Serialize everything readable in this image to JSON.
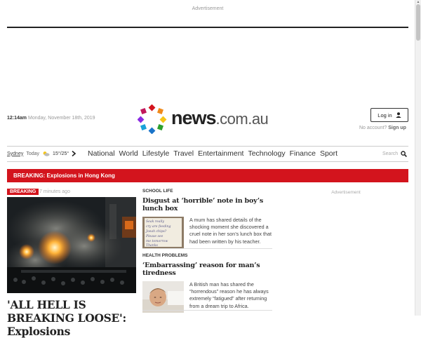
{
  "ads": {
    "top_label": "Advertisement",
    "side_label": "Advertisement"
  },
  "header": {
    "time": "12:14am",
    "date": "Monday, November 18th, 2019",
    "logo_main": "news",
    "logo_domain": ".com.au",
    "login_label": "Log in",
    "no_account_text": "No account?",
    "signup_label": "Sign up"
  },
  "weather": {
    "city": "Sydney",
    "day": "Today",
    "temps": "15°/25°"
  },
  "nav": {
    "items": [
      "National",
      "World",
      "Lifestyle",
      "Travel",
      "Entertainment",
      "Technology",
      "Finance",
      "Sport"
    ],
    "search_label": "Search"
  },
  "breaking_bar": {
    "text": "BREAKING: Explosions in Hong Kong"
  },
  "lead": {
    "tag": "BREAKING",
    "time_ago": "7 minutes ago",
    "headline": "'ALL HELL IS BREAKING LOOSE': Explosions"
  },
  "stories": [
    {
      "category": "SCHOOL LIFE",
      "headline": "Disgust at ‘horrible’ note in boy’s lunch box",
      "summary": "A mum has shared details of the shocking moment she discovered a cruel note in her son’s lunch box that had been written by his teacher.",
      "thumb_text": [
        "Seak really",
        "cry are feeding",
        "Joeah chips?",
        "Please see",
        "me tomorrow",
        "Thanks"
      ]
    },
    {
      "category": "HEALTH PROBLEMS",
      "headline": "‘Embarrassing’ reason for man’s tiredness",
      "summary": "A British man has shared the “horrendous” reason he has always extremely “fatigued” after returning from a dream trip to Africa."
    }
  ],
  "colors": {
    "accent": "#d3141d",
    "text": "#222222"
  }
}
